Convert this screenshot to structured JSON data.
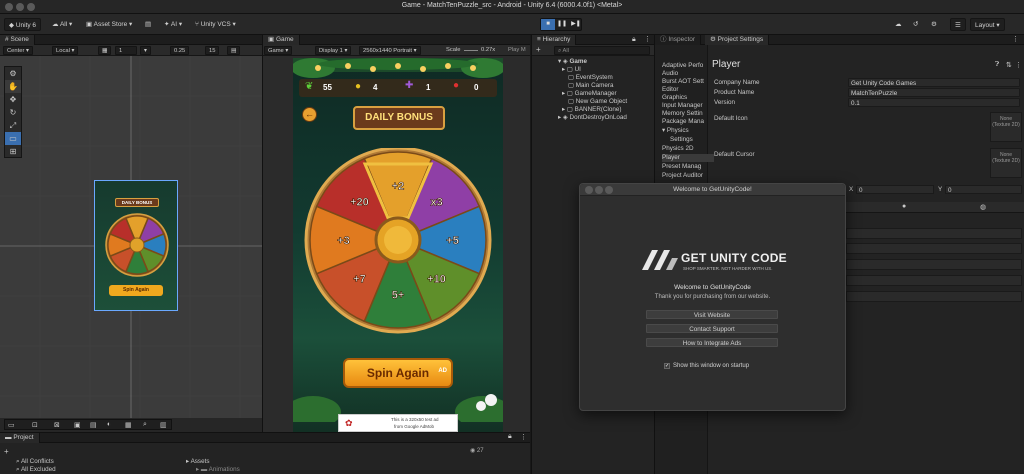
{
  "window": {
    "title": "Game - MatchTenPuzzle_src - Android - Unity 6.4 (6000.4.0f1) <Metal>"
  },
  "toolbar": {
    "account": "Unity 6",
    "all": "All",
    "asset_store": "Asset Store",
    "ai": "AI",
    "vcs": "Unity VCS",
    "layout": "Layout"
  },
  "scene": {
    "tab": "Scene",
    "center": "Center",
    "local": "Local",
    "grid_value": "1"
  },
  "game": {
    "tab": "Game",
    "mode": "Game",
    "display": "Display 1",
    "resolution": "2560x1440 Portrait",
    "scale_label": "Scale",
    "scale_value": "0.27x",
    "play_label": "Play M",
    "zoom_a": "0.25",
    "zoom_b": "15",
    "counters": [
      "55",
      "4",
      "1",
      "0"
    ],
    "daily_bonus": "DAILY BONUS",
    "wheel_labels": [
      "+2",
      "x3",
      "+5",
      "+10",
      "5+",
      "+7",
      "+3",
      "+20"
    ],
    "spin_button": "Spin Again",
    "spin_badge": "AD",
    "ad_text_1": "This is a 320x50 test ad",
    "ad_text_2": "from Google AdMob",
    "mini_daily_bonus": "DAILY BONUS",
    "mini_spin": "Spin Again"
  },
  "hierarchy": {
    "tab": "Hierarchy",
    "search": "All",
    "items": [
      {
        "label": "Game"
      },
      {
        "label": "UI"
      },
      {
        "label": "EventSystem"
      },
      {
        "label": "Main Camera"
      },
      {
        "label": "GameManager"
      },
      {
        "label": "New Game Object"
      },
      {
        "label": "BANNER(Clone)"
      },
      {
        "label": "DontDestroyOnLoad"
      }
    ]
  },
  "inspector": {
    "tab_inspector": "Inspector",
    "tab_project_settings": "Project Settings"
  },
  "project_settings": {
    "categories": [
      "Adaptive Perfo",
      "Audio",
      "Burst AOT Sett",
      "Editor",
      "Graphics",
      "Input Manager",
      "Memory Settin",
      "Package Mana",
      "Physics",
      "Settings",
      "Physics 2D",
      "Player",
      "Preset Manag",
      "Project Auditor"
    ],
    "player": {
      "heading": "Player",
      "company_label": "Company Name",
      "company_value": "Get Unity Code Games",
      "product_label": "Product Name",
      "product_value": "MatchTenPuzzle",
      "version_label": "Version",
      "version_value": "0.1",
      "default_icon_label": "Default Icon",
      "default_cursor_label": "Default Cursor",
      "none_text": "None",
      "texture_text": "(Texture 2D)",
      "x_label": "X",
      "x_value": "0",
      "y_label": "Y",
      "y_value": "0"
    }
  },
  "modal": {
    "title": "Welcome to GetUnityCode!",
    "logo_text": "GET UNITY CODE",
    "tagline": "SHOP SMARTER. NOT HARDER WITH US.",
    "welcome": "Welcome to GetUnityCode",
    "thanks": "Thank you for purchasing from our website.",
    "buttons": [
      "Visit Website",
      "Contact Support",
      "How to Integrate Ads"
    ],
    "checkbox_label": "Show this window on startup"
  },
  "project": {
    "tab": "Project",
    "items": [
      "All Conflicts",
      "All Excluded"
    ],
    "assets_label": "Assets",
    "animations_label": "Animations",
    "count": "27"
  },
  "colors": {
    "accent": "#3a6fb0",
    "wheel": [
      "#e4a02b",
      "#8f3fa6",
      "#2a7fbf",
      "#5f8f2a",
      "#2f7f3a",
      "#c8502a",
      "#e07a1f",
      "#b82f2a"
    ]
  }
}
